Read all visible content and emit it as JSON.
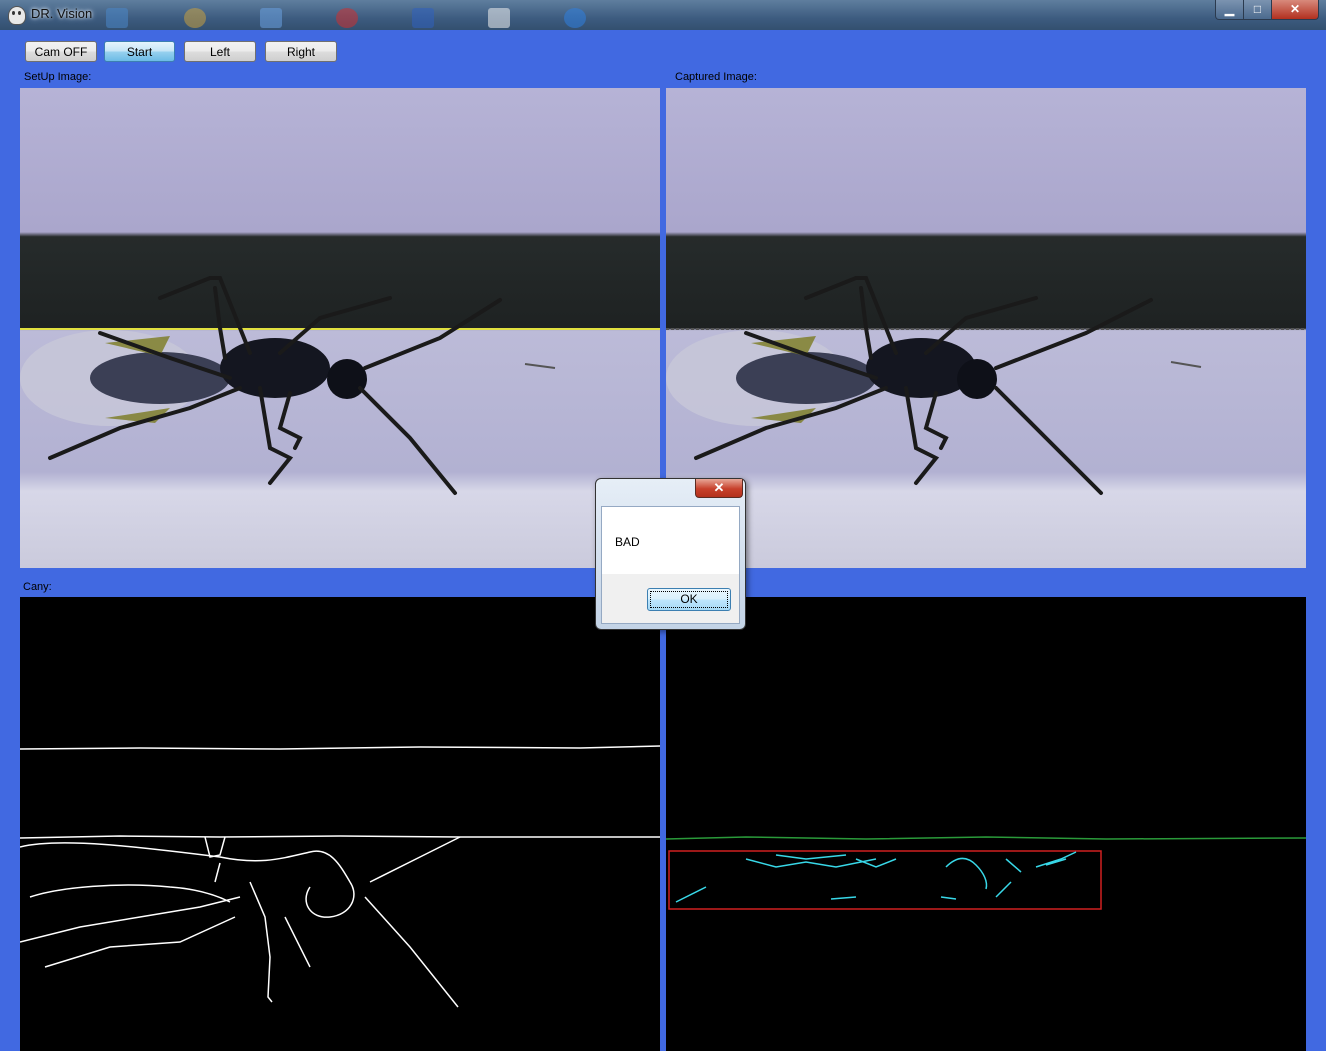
{
  "window": {
    "title": "DR. Vision"
  },
  "toolbar": {
    "cam_label": "Cam OFF",
    "start_label": "Start",
    "left_label": "Left",
    "right_label": "Right"
  },
  "panels": {
    "setup_label": "SetUp Image:",
    "captured_label": "Captured Image:",
    "canny_label": "Cany:"
  },
  "dialog": {
    "message": "BAD",
    "ok_label": "OK",
    "close_glyph": "✕"
  },
  "window_controls": {
    "minimize": "▁",
    "maximize": "□",
    "close": "✕"
  },
  "colors": {
    "accent": "#4169e1",
    "alignment_line": "#e0e040",
    "detected_edges": "#38d8e8",
    "region_box": "#d02020"
  }
}
